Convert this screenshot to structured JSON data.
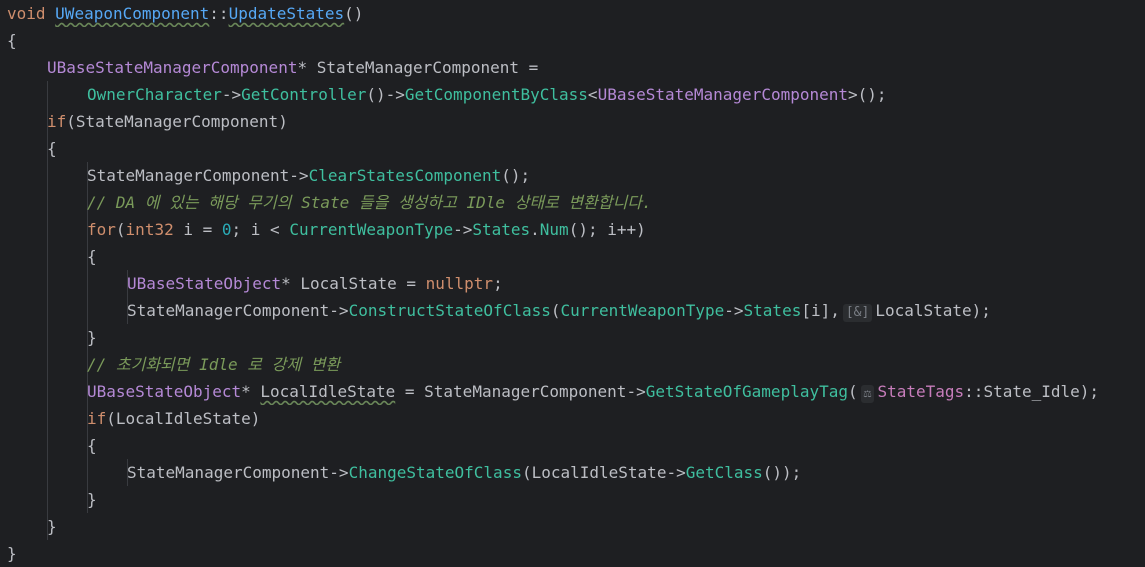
{
  "lines": [
    {
      "indent": 0,
      "tokens": [
        [
          "kw",
          "void "
        ],
        [
          "fn-uline",
          "UWeaponComponent"
        ],
        [
          "punc",
          "::"
        ],
        [
          "fn-uline",
          "UpdateStates"
        ],
        [
          "punc",
          "()"
        ]
      ]
    },
    {
      "indent": 0,
      "tokens": [
        [
          "punc",
          "{"
        ]
      ]
    },
    {
      "indent": 1,
      "tokens": [
        [
          "typ",
          "UBaseStateManagerComponent"
        ],
        [
          "punc",
          "* "
        ],
        [
          "var",
          "StateManagerComponent ="
        ]
      ]
    },
    {
      "indent": 2,
      "tokens": [
        [
          "green-call",
          "OwnerCharacter"
        ],
        [
          "punc",
          "->"
        ],
        [
          "green-call",
          "GetController"
        ],
        [
          "punc",
          "()->"
        ],
        [
          "green-call",
          "GetComponentByClass"
        ],
        [
          "punc",
          "<"
        ],
        [
          "typ",
          "UBaseStateManagerComponent"
        ],
        [
          "punc",
          ">();"
        ]
      ]
    },
    {
      "indent": 1,
      "tokens": [
        [
          "kw",
          "if"
        ],
        [
          "punc",
          "(StateManagerComponent)"
        ]
      ]
    },
    {
      "indent": 1,
      "tokens": [
        [
          "punc",
          "{"
        ]
      ]
    },
    {
      "indent": 2,
      "tokens": [
        [
          "var",
          "StateManagerComponent"
        ],
        [
          "punc",
          "->"
        ],
        [
          "green-call",
          "ClearStatesComponent"
        ],
        [
          "punc",
          "();"
        ]
      ]
    },
    {
      "indent": 2,
      "tokens": [
        [
          "cm",
          "// DA 에 있는 해당 무기의 State 들을 생성하고 IDle 상태로 변환합니다."
        ]
      ]
    },
    {
      "indent": 2,
      "tokens": [
        [
          "kw",
          "for"
        ],
        [
          "punc",
          "("
        ],
        [
          "kw",
          "int32 "
        ],
        [
          "var",
          "i = "
        ],
        [
          "num",
          "0"
        ],
        [
          "punc",
          "; i < "
        ],
        [
          "green-call",
          "CurrentWeaponType"
        ],
        [
          "punc",
          "->"
        ],
        [
          "green-call",
          "States"
        ],
        [
          "punc",
          "."
        ],
        [
          "green-call",
          "Num"
        ],
        [
          "punc",
          "(); i++)"
        ]
      ]
    },
    {
      "indent": 2,
      "tokens": [
        [
          "punc",
          "{"
        ]
      ]
    },
    {
      "indent": 3,
      "tokens": [
        [
          "typ",
          "UBaseStateObject"
        ],
        [
          "punc",
          "* "
        ],
        [
          "var",
          "LocalState = "
        ],
        [
          "kw",
          "nullptr"
        ],
        [
          "punc",
          ";"
        ]
      ]
    },
    {
      "indent": 3,
      "tokens": [
        [
          "var",
          "StateManagerComponent"
        ],
        [
          "punc",
          "->"
        ],
        [
          "green-call",
          "ConstructStateOfClass"
        ],
        [
          "punc",
          "("
        ],
        [
          "green-call",
          "CurrentWeaponType"
        ],
        [
          "punc",
          "->"
        ],
        [
          "green-call",
          "States"
        ],
        [
          "punc",
          "[i],"
        ],
        [
          "hint",
          "[&]"
        ],
        [
          "var",
          "LocalState"
        ],
        [
          "punc",
          ");"
        ]
      ]
    },
    {
      "indent": 2,
      "tokens": [
        [
          "punc",
          "}"
        ]
      ]
    },
    {
      "indent": 2,
      "tokens": [
        [
          "cm",
          "// 초기화되면 Idle 로 강제 변환"
        ]
      ]
    },
    {
      "indent": 2,
      "tokens": [
        [
          "typ",
          "UBaseStateObject"
        ],
        [
          "punc",
          "* "
        ],
        [
          "var-uline",
          "LocalIdleState"
        ],
        [
          "punc",
          " = StateManagerComponent->"
        ],
        [
          "green-call",
          "GetStateOfGameplayTag"
        ],
        [
          "punc",
          "("
        ],
        [
          "hint",
          "⚖"
        ],
        [
          "mem",
          "StateTags"
        ],
        [
          "punc",
          "::State_Idle);"
        ]
      ]
    },
    {
      "indent": 2,
      "tokens": [
        [
          "kw",
          "if"
        ],
        [
          "punc",
          "(LocalIdleState)"
        ]
      ]
    },
    {
      "indent": 2,
      "tokens": [
        [
          "punc",
          "{"
        ]
      ]
    },
    {
      "indent": 3,
      "tokens": [
        [
          "var",
          "StateManagerComponent"
        ],
        [
          "punc",
          "->"
        ],
        [
          "green-call",
          "ChangeStateOfClass"
        ],
        [
          "punc",
          "(LocalIdleState->"
        ],
        [
          "green-call",
          "GetClass"
        ],
        [
          "punc",
          "());"
        ]
      ]
    },
    {
      "indent": 2,
      "tokens": [
        [
          "punc",
          "}"
        ]
      ]
    },
    {
      "indent": 1,
      "tokens": [
        [
          "punc",
          "}"
        ]
      ]
    },
    {
      "indent": 0,
      "tokens": [
        [
          "punc",
          "}"
        ]
      ]
    }
  ]
}
